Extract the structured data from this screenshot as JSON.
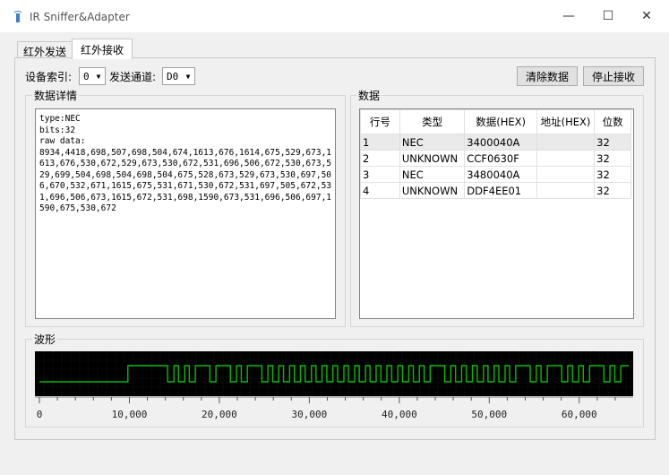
{
  "window": {
    "title": "IR Sniffer&Adapter",
    "controls": [
      "—",
      "☐",
      "✕"
    ]
  },
  "tabs": [
    {
      "label": "红外发送",
      "active": false
    },
    {
      "label": "红外接收",
      "active": true
    }
  ],
  "toolbar": {
    "device_label": "设备索引:",
    "device_value": "0",
    "channel_label": "发送通道:",
    "channel_value": "D0",
    "clear_button": "清除数据",
    "stop_button": "停止接收"
  },
  "details": {
    "title": "数据详情",
    "text": "type:NEC\nbits:32\nraw data:\n8934,4418,698,507,698,504,674,1613,676,1614,675,529,673,1613,676,530,672,529,673,530,672,531,696,506,672,530,673,529,699,504,698,504,698,504,675,528,673,529,673,530,697,506,670,532,671,1615,675,531,671,530,672,531,697,505,672,531,696,506,673,1615,672,531,698,1590,673,531,696,506,697,1590,675,530,672"
  },
  "data_table": {
    "title": "数据",
    "columns": [
      "行号",
      "类型",
      "数据(HEX)",
      "地址(HEX)",
      "位数"
    ],
    "rows": [
      [
        "1",
        "NEC",
        "3400040A",
        "",
        "32"
      ],
      [
        "2",
        "UNKNOWN",
        "CCF0630F",
        "",
        "32"
      ],
      [
        "3",
        "NEC",
        "3480040A",
        "",
        "32"
      ],
      [
        "4",
        "UNKNOWN",
        "DDF4EE01",
        "",
        "32"
      ]
    ]
  },
  "waveform": {
    "title": "波形",
    "axis_ticks": [
      "0",
      "10,000",
      "20,000",
      "30,000",
      "40,000",
      "50,000",
      "60,000"
    ],
    "axis_tick_values": [
      0,
      10000,
      20000,
      30000,
      40000,
      50000,
      60000
    ],
    "x_range": [
      0,
      65500
    ],
    "signal_color": "#00c000",
    "background_color": "#000000",
    "grid_color": "#2a2a2a"
  }
}
